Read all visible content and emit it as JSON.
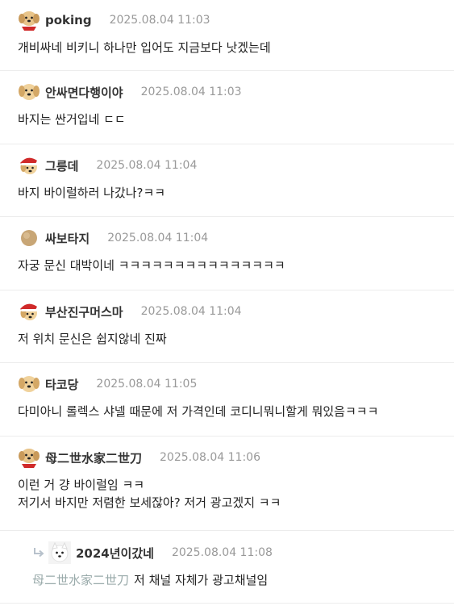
{
  "comments": [
    {
      "author": "poking",
      "date": "2025.08.04 11:03",
      "avatar": "dog-red-scarf-icon",
      "lines": [
        "개비싸네 비키니 하나만 입어도 지금보다 낫겠는데"
      ]
    },
    {
      "author": "안싸면다행이야",
      "date": "2025.08.04 11:03",
      "avatar": "dog-icon",
      "lines": [
        "바지는 싼거입네 ㄷㄷ"
      ]
    },
    {
      "author": "그릉데",
      "date": "2025.08.04 11:04",
      "avatar": "dog-santa-hat-icon",
      "lines": [
        "바지 바이럴하러 나갔나?ㅋㅋ"
      ]
    },
    {
      "author": "싸보타지",
      "date": "2025.08.04 11:04",
      "avatar": "brown-circle-icon",
      "lines": [
        "자궁 문신 대박이네 ㅋㅋㅋㅋㅋㅋㅋㅋㅋㅋㅋㅋㅋㅋㅋ"
      ]
    },
    {
      "author": "부산진구머스마",
      "date": "2025.08.04 11:04",
      "avatar": "dog-santa-hat-icon",
      "lines": [
        "저 위치 문신은 쉽지않네 진짜"
      ]
    },
    {
      "author": "타코당",
      "date": "2025.08.04 11:05",
      "avatar": "dog-icon",
      "lines": [
        "다미아니 롤렉스 샤넬 때문에 저 가격인데 코디니뭐니할게 뭐있음ㅋㅋㅋ"
      ]
    },
    {
      "author": "母二世水家二世刀",
      "date": "2025.08.04 11:06",
      "avatar": "dog-red-scarf-icon",
      "lines": [
        "이런 거 걍 바이럴임 ㅋㅋ",
        "저기서 바지만 저렴한 보세잖아? 저거 광고겠지 ㅋㅋ"
      ]
    }
  ],
  "reply": {
    "author": "2024년이갔네",
    "date": "2025.08.04 11:08",
    "avatar": "white-dog-icon",
    "mention": "母二世水家二世刀",
    "text": "저 채널 자체가 광고채널임"
  }
}
